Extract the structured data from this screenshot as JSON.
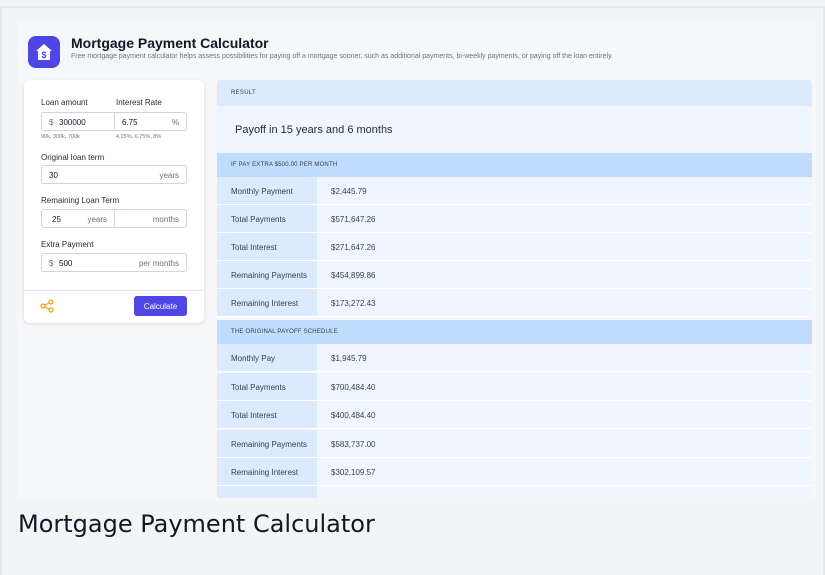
{
  "app": {
    "title": "Mortgage Payment Calculator",
    "subtitle": "Free mortgage payment calculator helps assess possibilities for paying off a mortgage sooner, such as additional payments, bi-weekly payments, or paying off the loan entirely.",
    "logo_icon": "house-dollar-icon",
    "brand_color": "#4f46e5"
  },
  "form": {
    "loan_amount_label": "Loan amount",
    "loan_amount_prefix": "$",
    "loan_amount_value": "300000",
    "loan_amount_hint": "90k, 300k, 700k",
    "interest_rate_label": "Interest Rate",
    "interest_rate_value": "6.75",
    "interest_rate_suffix": "%",
    "interest_rate_hint": "4.25%, 6.75%, 8%",
    "original_term_label": "Original loan term",
    "original_term_value": "30",
    "original_term_suffix": "years",
    "remaining_term_label": "Remaining Loan Term",
    "remaining_years_value": "25",
    "remaining_years_suffix": "years",
    "remaining_months_suffix": "months",
    "extra_payment_label": "Extra Payment",
    "extra_payment_prefix": "$",
    "extra_payment_value": "500",
    "extra_payment_suffix": "per months",
    "calculate_label": "Calculate",
    "share_icon": "share-icon"
  },
  "result": {
    "header": "RESULT",
    "payoff_text": "Payoff in 15 years and 6 months",
    "extra_section_title": "IF PAY EXTRA $500.00 PER MONTH",
    "extra_rows": [
      {
        "label": "Monthly Payment",
        "value": "$2,445.79"
      },
      {
        "label": "Total Payments",
        "value": "$571,647.26"
      },
      {
        "label": "Total Interest",
        "value": "$271,647.26"
      },
      {
        "label": "Remaining Payments",
        "value": "$454,899.86"
      },
      {
        "label": "Remaining Interest",
        "value": "$173,272.43"
      }
    ],
    "original_section_title": "THE ORIGINAL PAYOFF SCHEDULE",
    "original_rows": [
      {
        "label": "Monthly Pay",
        "value": "$1,945.79"
      },
      {
        "label": "Total Payments",
        "value": "$700,484.40"
      },
      {
        "label": "Total Interest",
        "value": "$400,484.40"
      },
      {
        "label": "Remaining Payments",
        "value": "$583,737.00"
      },
      {
        "label": "Remaining Interest",
        "value": "$302,109.57"
      }
    ]
  },
  "caption": "Mortgage Payment Calculator"
}
